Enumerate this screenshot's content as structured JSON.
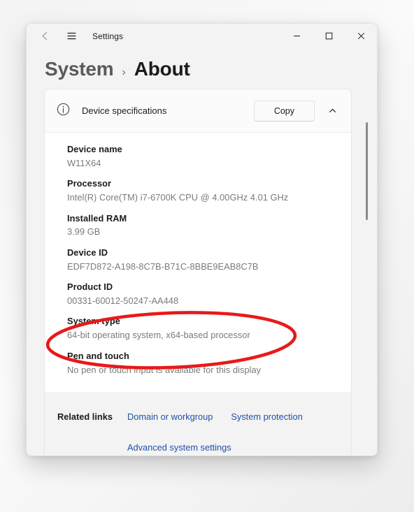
{
  "titlebar": {
    "back_icon": "back-arrow-icon",
    "menu_icon": "hamburger-menu-icon",
    "app_title": "Settings",
    "minimize_label": "—",
    "maximize_label": "□",
    "close_label": "✕"
  },
  "breadcrumb": {
    "parent": "System",
    "separator": "›",
    "current": "About"
  },
  "card": {
    "icon": "info-circle-icon",
    "title": "Device specifications",
    "copy_label": "Copy",
    "collapse_icon": "chevron-up-icon",
    "specs": [
      {
        "label": "Device name",
        "value": "W11X64"
      },
      {
        "label": "Processor",
        "value": "Intel(R) Core(TM) i7-6700K CPU @ 4.00GHz   4.01 GHz"
      },
      {
        "label": "Installed RAM",
        "value": "3.99 GB"
      },
      {
        "label": "Device ID",
        "value": "EDF7D872-A198-8C7B-B71C-8BBE9EAB8C7B"
      },
      {
        "label": "Product ID",
        "value": "00331-60012-50247-AA448"
      },
      {
        "label": "System type",
        "value": "64-bit operating system, x64-based processor"
      },
      {
        "label": "Pen and touch",
        "value": "No pen or touch input is available for this display"
      }
    ]
  },
  "related_links": {
    "title": "Related links",
    "links": [
      "Domain or workgroup",
      "System protection",
      "Advanced system settings"
    ]
  },
  "annotation": {
    "type": "ellipse-highlight",
    "color": "#e8191b",
    "target": "System type"
  },
  "colors": {
    "window_bg": "#f3f3f3",
    "card_bg": "#ffffff",
    "link": "#1f50a8",
    "label": "#1b1b1b",
    "value": "#7a7a7a",
    "annotation_red": "#e8191b"
  }
}
